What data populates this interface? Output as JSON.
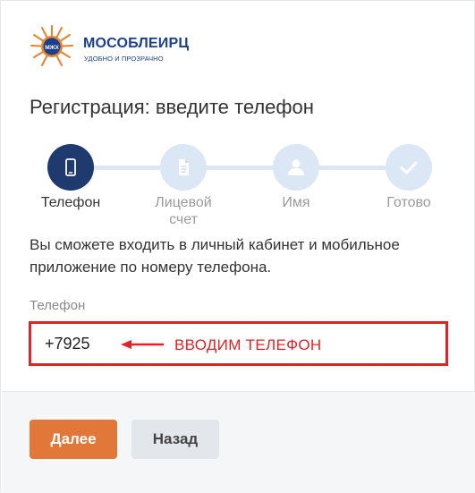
{
  "brand": {
    "name": "МОСОБЛЕИРЦ",
    "tagline": "УДОБНО И ПРОЗРАЧНО",
    "mark_text": "МЖХ",
    "colors": {
      "primary": "#1b3f8f",
      "sun": "#e8822e"
    }
  },
  "page": {
    "title": "Регистрация: введите телефон"
  },
  "stepper": {
    "steps": [
      {
        "label": "Телефон",
        "icon": "phone-icon",
        "active": true
      },
      {
        "label": "Лицевой счет",
        "icon": "document-icon",
        "active": false
      },
      {
        "label": "Имя",
        "icon": "user-icon",
        "active": false
      },
      {
        "label": "Готово",
        "icon": "checkmark-icon",
        "active": false
      }
    ],
    "colors": {
      "active": "#1e3a6e",
      "inactive": "#dce7f5"
    }
  },
  "form": {
    "description": "Вы сможете входить в личный кабинет и мобильное приложение по номеру телефона.",
    "phone": {
      "label": "Телефон",
      "value": "+7925"
    },
    "annotation": "ВВОДИМ ТЕЛЕФОН"
  },
  "footer": {
    "next_label": "Далее",
    "back_label": "Назад",
    "colors": {
      "next": "#e2773a",
      "back": "#e3e6eb"
    }
  }
}
